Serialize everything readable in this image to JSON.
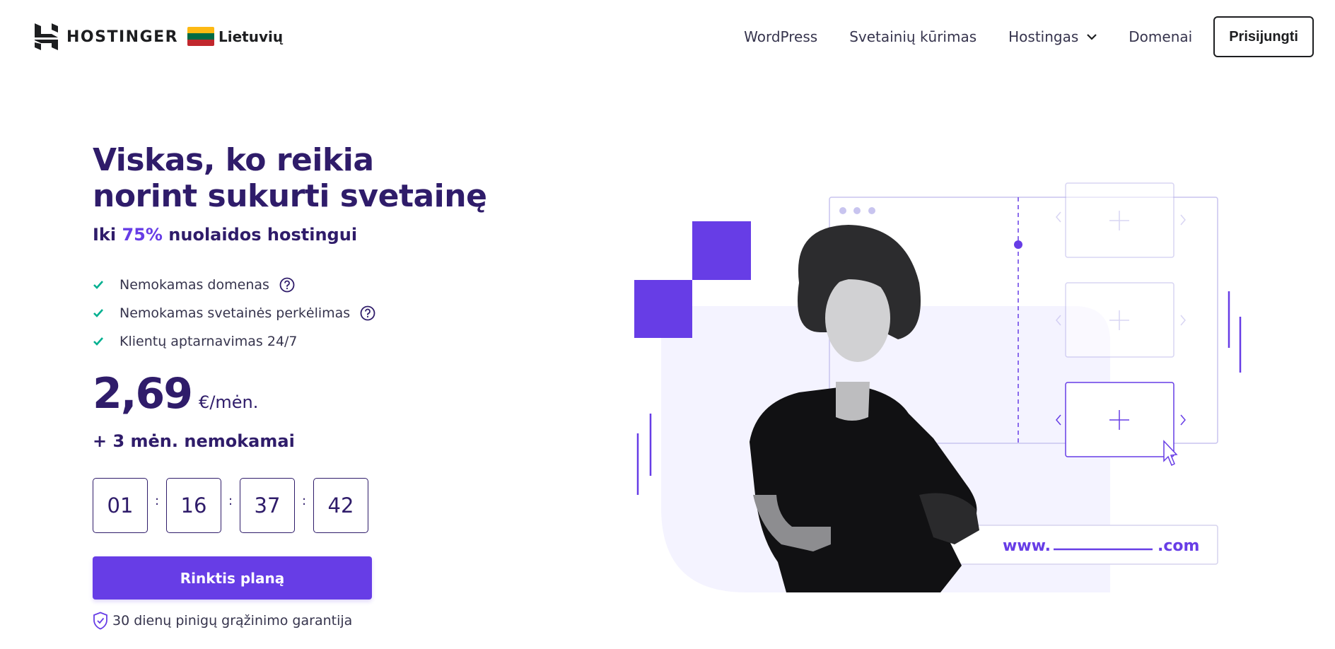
{
  "header": {
    "brand": "HOSTINGER",
    "language": "Lietuvių",
    "flag_colors": [
      "#fdb913",
      "#006a44",
      "#c1272d"
    ],
    "nav": [
      {
        "label": "WordPress"
      },
      {
        "label": "Svetainių kūrimas"
      },
      {
        "label": "Hostingas",
        "has_dropdown": true
      },
      {
        "label": "Domenai"
      }
    ],
    "login_label": "Prisijungti"
  },
  "hero": {
    "title": "Viskas, ko reikia norint sukurti svetainę",
    "subtitle_prefix": "Iki ",
    "subtitle_highlight": "75%",
    "subtitle_suffix": " nuolaidos hostingui",
    "features": [
      {
        "label": "Nemokamas domenas",
        "has_help": true
      },
      {
        "label": "Nemokamas svetainės perkėlimas",
        "has_help": true
      },
      {
        "label": "Klientų aptarnavimas 24/7",
        "has_help": false
      }
    ],
    "price_value": "2,69",
    "price_unit": "€/mėn.",
    "free_months": "+ 3 mėn. nemokamai",
    "timer": [
      "01",
      "16",
      "37",
      "42"
    ],
    "timer_separator": ":",
    "cta_label": "Rinktis planą",
    "guarantee": "30 dienų pinigų grąžinimo garantija"
  },
  "illustration": {
    "domain_prefix": "www.",
    "domain_suffix": ".com"
  },
  "colors": {
    "brand_purple": "#673de6",
    "heading": "#2f1c6a",
    "check_green": "#00b090",
    "light_bg": "#f4f3ff"
  }
}
